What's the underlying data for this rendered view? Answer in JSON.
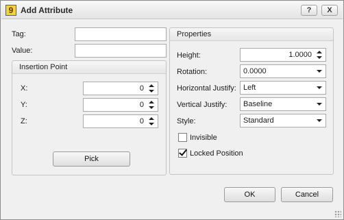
{
  "window": {
    "title": "Add Attribute",
    "app_icon_glyph": "9",
    "help_label": "?",
    "close_label": "X"
  },
  "left": {
    "tag_label": "Tag:",
    "tag_value": "",
    "value_label": "Value:",
    "value_value": "",
    "insertion": {
      "title": "Insertion Point",
      "x_label": "X:",
      "x_value": "0",
      "y_label": "Y:",
      "y_value": "0",
      "z_label": "Z:",
      "z_value": "0",
      "pick_label": "Pick"
    }
  },
  "properties": {
    "title": "Properties",
    "height_label": "Height:",
    "height_value": "1.0000",
    "rotation_label": "Rotation:",
    "rotation_value": "0.0000",
    "hjustify_label": "Horizontal Justify:",
    "hjustify_value": "Left",
    "vjustify_label": "Vertical Justify:",
    "vjustify_value": "Baseline",
    "style_label": "Style:",
    "style_value": "Standard",
    "invisible_label": "Invisible",
    "invisible_checked": false,
    "locked_label": "Locked Position",
    "locked_checked": true
  },
  "footer": {
    "ok_label": "OK",
    "cancel_label": "Cancel"
  }
}
